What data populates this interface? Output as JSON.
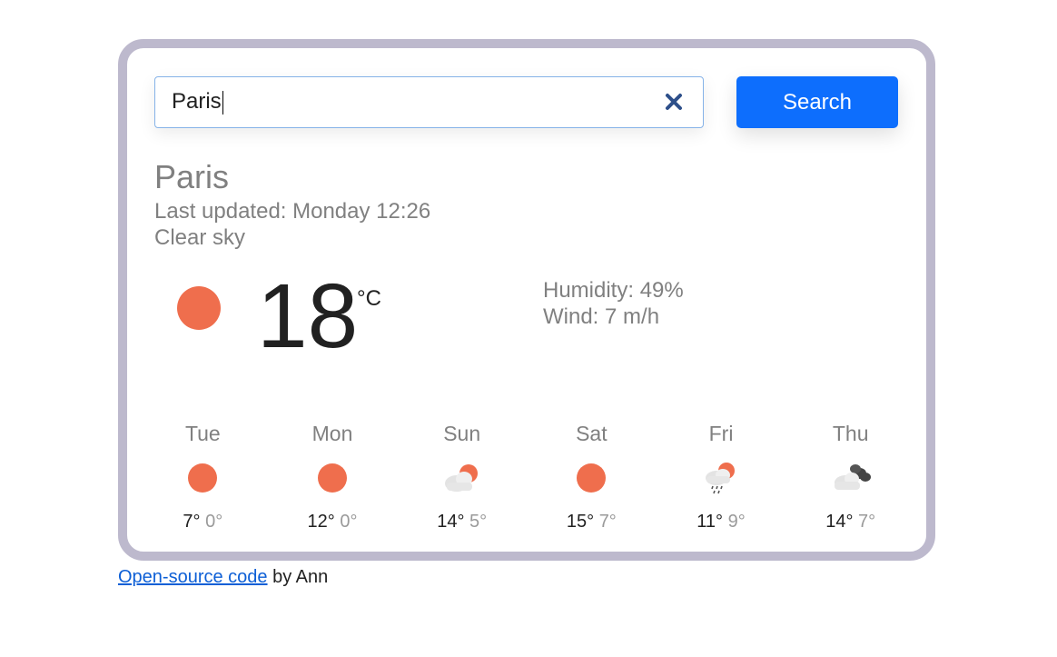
{
  "search": {
    "value": "Paris",
    "button_label": "Search"
  },
  "current": {
    "city": "Paris",
    "last_updated": "Last updated: Monday 12:26",
    "description": "Clear sky",
    "temperature": "18",
    "unit": "°C",
    "humidity": "Humidity: 49%",
    "wind": "Wind: 7 m/h",
    "icon": "sun-icon"
  },
  "forecast": [
    {
      "day": "Tue",
      "max": "7°",
      "min": "0°",
      "icon": "sun-icon"
    },
    {
      "day": "Mon",
      "max": "12°",
      "min": "0°",
      "icon": "sun-icon"
    },
    {
      "day": "Sun",
      "max": "14°",
      "min": "5°",
      "icon": "partly-cloudy-icon"
    },
    {
      "day": "Sat",
      "max": "15°",
      "min": "7°",
      "icon": "sun-icon"
    },
    {
      "day": "Fri",
      "max": "11°",
      "min": "9°",
      "icon": "rain-sun-icon"
    },
    {
      "day": "Thu",
      "max": "14°",
      "min": "7°",
      "icon": "cloudy-icon"
    }
  ],
  "footer": {
    "link_text": "Open-source code",
    "by_text": " by Ann"
  },
  "colors": {
    "accent": "#0d6efd",
    "sun": "#ef6e4d",
    "card_border": "#bdb9cd",
    "muted_text": "#808080"
  }
}
